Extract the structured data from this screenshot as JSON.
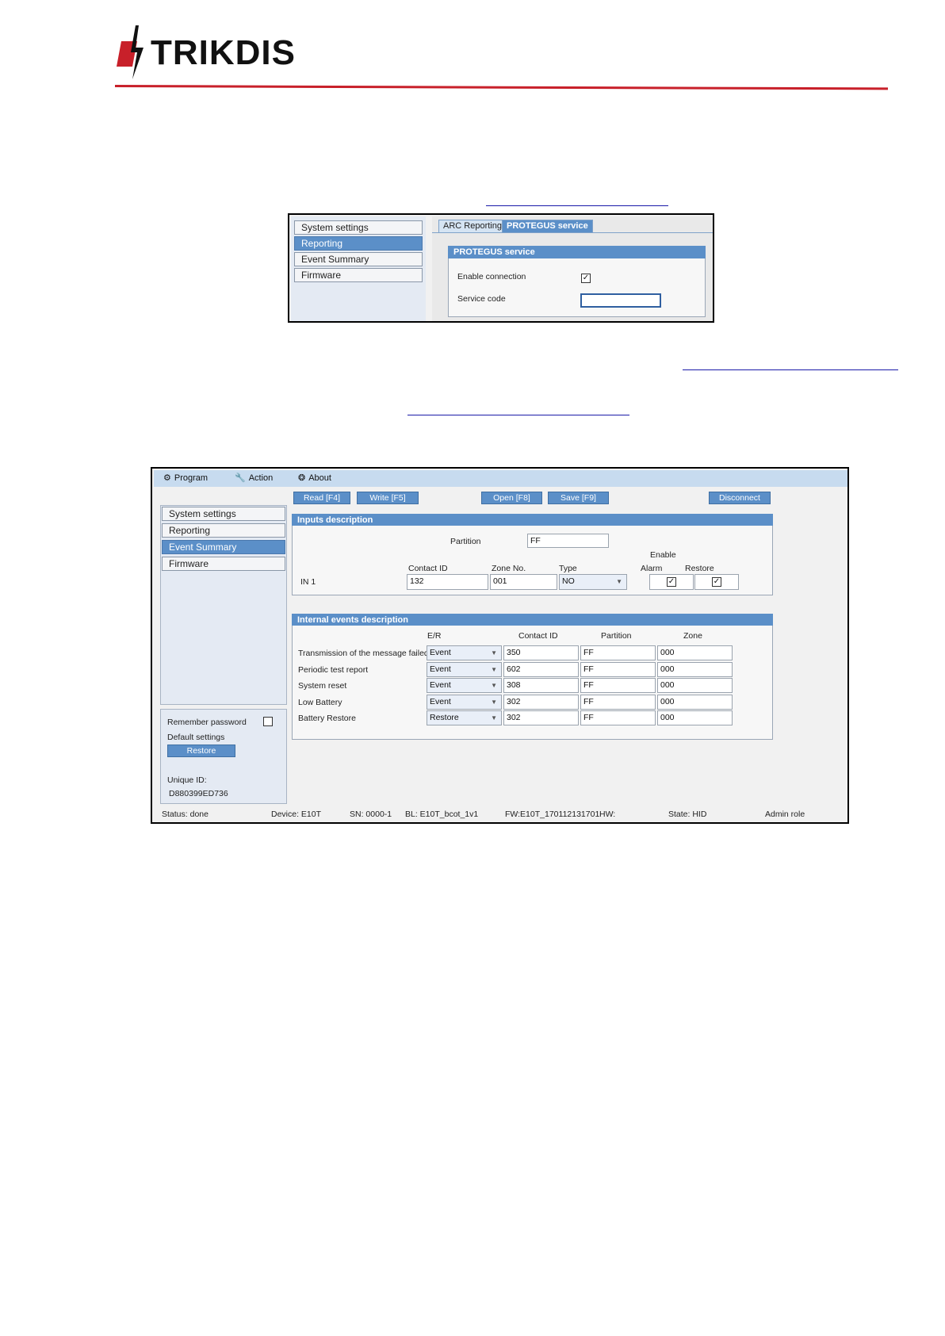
{
  "brand": {
    "logo_text": "TRIKDIS",
    "accent": "#c8202a"
  },
  "screenshot1": {
    "sidebar": [
      "System settings",
      "Reporting",
      "Event Summary",
      "Firmware"
    ],
    "active_sidebar": "Reporting",
    "tabs": [
      "ARC Reporting",
      "PROTEGUS service"
    ],
    "active_tab": "PROTEGUS service",
    "group_title": "PROTEGUS service",
    "enable_label": "Enable connection",
    "enable_checked": true,
    "service_code_label": "Service code",
    "service_code_value": ""
  },
  "screenshot2": {
    "menu": [
      "Program",
      "Action",
      "About"
    ],
    "toolbar": [
      "Read [F4]",
      "Write [F5]",
      "Open [F8]",
      "Save [F9]",
      "Disconnect"
    ],
    "sidebar": [
      "System settings",
      "Reporting",
      "Event Summary",
      "Firmware"
    ],
    "active_sidebar": "Event Summary",
    "left_bottom": {
      "remember_password": "Remember password",
      "default_settings": "Default settings",
      "restore_button": "Restore",
      "unique_id_label": "Unique ID:",
      "unique_id_value": "D880399ED736"
    },
    "inputs": {
      "title": "Inputs description",
      "partition_label": "Partition",
      "partition_value": "FF",
      "enable_header": "Enable",
      "headers": [
        "Contact ID",
        "Zone No.",
        "Type",
        "Alarm",
        "Restore"
      ],
      "row": {
        "name": "IN 1",
        "contact_id": "132",
        "zone": "001",
        "type": "NO",
        "alarm": true,
        "restore": true
      }
    },
    "internal": {
      "title": "Internal events description",
      "headers": [
        "E/R",
        "Contact ID",
        "Partition",
        "Zone"
      ],
      "rows": [
        {
          "name": "Transmission of the message failed",
          "er": "Event",
          "contact_id": "350",
          "partition": "FF",
          "zone": "000"
        },
        {
          "name": "Periodic test report",
          "er": "Event",
          "contact_id": "602",
          "partition": "FF",
          "zone": "000"
        },
        {
          "name": "System reset",
          "er": "Event",
          "contact_id": "308",
          "partition": "FF",
          "zone": "000"
        },
        {
          "name": "Low Battery",
          "er": "Event",
          "contact_id": "302",
          "partition": "FF",
          "zone": "000"
        },
        {
          "name": "Battery Restore",
          "er": "Restore",
          "contact_id": "302",
          "partition": "FF",
          "zone": "000"
        }
      ]
    },
    "status": {
      "status": "Status: done",
      "device": "Device:  E10T",
      "sn": "SN: 0000-1",
      "bl": "BL: E10T_bcot_1v1",
      "fw": "FW:E10T_170112131701",
      "hw": "HW:",
      "state": "State:  HID",
      "role": "Admin role"
    }
  }
}
